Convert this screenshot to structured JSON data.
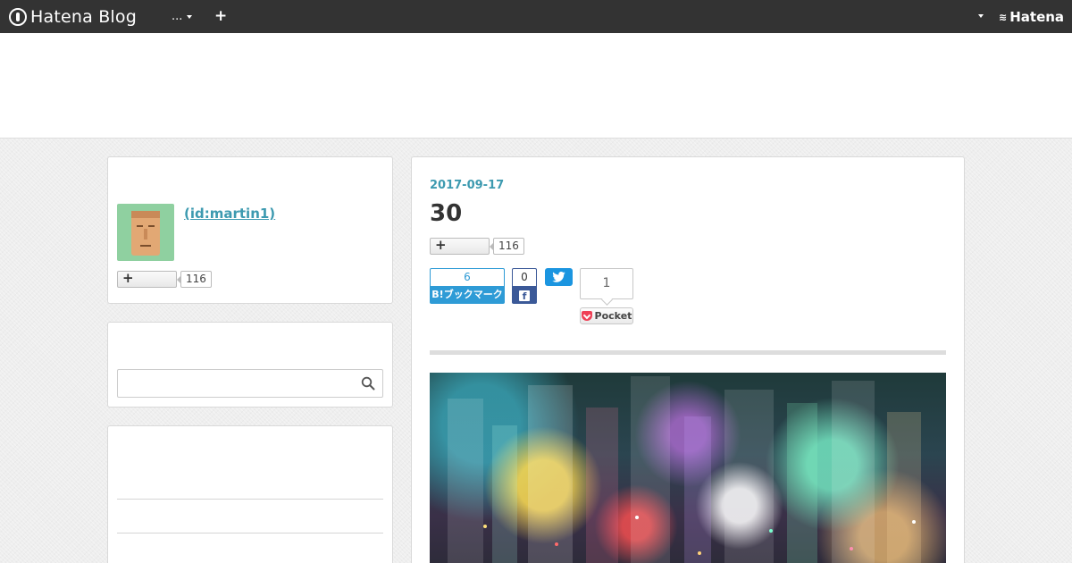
{
  "navbar": {
    "logo_text": "Hatena Blog",
    "more_label": "...",
    "add_label": "+",
    "brand_right": "Hatena"
  },
  "profile": {
    "name_label": " (id:martin1)",
    "subscribe_icon": "+",
    "subscriber_count": "116"
  },
  "search": {
    "value": "",
    "placeholder": ""
  },
  "article": {
    "date": "2017-09-17",
    "title": "30",
    "subscribe_icon": "+",
    "subscriber_count": "116",
    "share": {
      "hatena_bookmark_count": "6",
      "hatena_bookmark_label": "B!ブックマーク",
      "facebook_count": "0",
      "facebook_label": "f",
      "pocket_count": "1",
      "pocket_label": "Pocket"
    }
  },
  "colors": {
    "navbar": "#333333",
    "accent_link": "#3d9ab0",
    "hatena_bookmark": "#2e9bd6",
    "facebook": "#3b5998",
    "twitter": "#1b95e0",
    "pocket": "#ef4056"
  },
  "icons": [
    "hatena-logo-icon",
    "caret-down-icon",
    "plus-icon",
    "search-icon",
    "twitter-bird-icon",
    "facebook-icon",
    "pocket-icon"
  ]
}
